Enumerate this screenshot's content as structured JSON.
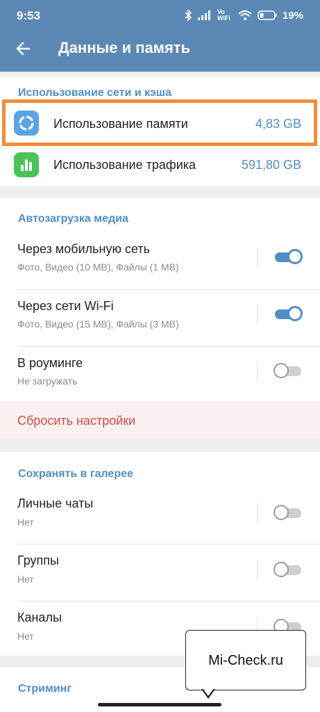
{
  "status_bar": {
    "time": "9:53",
    "network_label": "Vo WiFi",
    "battery": "19%"
  },
  "app_bar": {
    "title": "Данные и память"
  },
  "network_section": {
    "title": "Использование сети и кэша",
    "items": [
      {
        "label": "Использование памяти",
        "value": "4,83 GB",
        "icon": "storage-usage-icon",
        "icon_color": "#5aa3e6"
      },
      {
        "label": "Использование трафика",
        "value": "591,80 GB",
        "icon": "traffic-usage-icon",
        "icon_color": "#4cc25a"
      }
    ]
  },
  "autodownload_section": {
    "title": "Автозагрузка медиа",
    "items": [
      {
        "label": "Через мобильную сеть",
        "sub": "Фото, Видео (10 MB), Файлы (1 MB)",
        "enabled": true
      },
      {
        "label": "Через сети Wi-Fi",
        "sub": "Фото, Видео (15 MB), Файлы (3 MB)",
        "enabled": true
      },
      {
        "label": "В роуминге",
        "sub": "Не загружать",
        "enabled": false
      }
    ],
    "reset_label": "Сбросить настройки"
  },
  "gallery_section": {
    "title": "Сохранять в галерее",
    "items": [
      {
        "label": "Личные чаты",
        "sub": "Нет",
        "enabled": false
      },
      {
        "label": "Группы",
        "sub": "Нет",
        "enabled": false
      },
      {
        "label": "Каналы",
        "sub": "Нет",
        "enabled": false
      }
    ]
  },
  "streaming_section": {
    "title": "Стриминг"
  },
  "watermark": {
    "text": "Mi-Check.ru"
  },
  "colors": {
    "header": "#5b88b5",
    "accent": "#4f8ec6",
    "highlight_border": "#f28c3a",
    "danger": "#d34b4b"
  }
}
